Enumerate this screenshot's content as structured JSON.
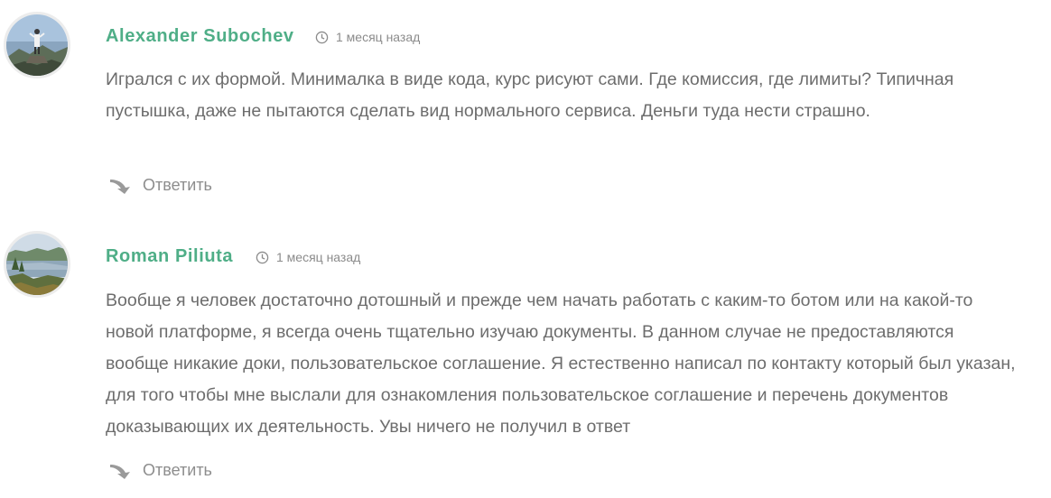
{
  "comments": [
    {
      "author": "Alexander Subochev",
      "time": "1 месяц назад",
      "text": "Игрался с их формой. Минималка в виде кода, курс рисуют сами. Где комиссия, где лимиты? Типичная пустышка, даже не пытаются сделать вид нормального сервиса. Деньги туда нести страшно.",
      "reply_label": "Ответить",
      "avatar_icon": "avatar-person-on-mountain"
    },
    {
      "author": "Roman Piliuta",
      "time": "1 месяц назад",
      "text": "Вообще я человек достаточно дотошный и прежде чем начать работать с каким-то ботом или на какой-то новой платформе, я всегда очень тщательно изучаю документы. В данном случае не предоставляются вообще никакие доки, пользовательское соглашение. Я естественно написал по контакту который был указан, для того чтобы мне выслали для ознакомления пользовательское соглашение и перечень документов доказывающих их деятельность. Увы ничего не получил в ответ",
      "reply_label": "Ответить",
      "avatar_icon": "avatar-lake-landscape"
    }
  ],
  "colors": {
    "author": "#4fae87",
    "text": "#6d6d6d",
    "meta": "#8b8b8b"
  }
}
